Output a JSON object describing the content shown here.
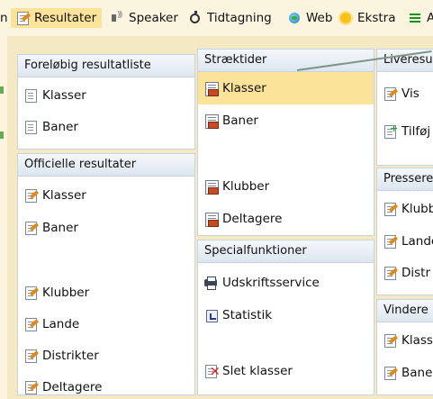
{
  "menubar": {
    "partial_left": "n",
    "items": [
      {
        "label": "Resultater",
        "icon": "result-doc-icon"
      },
      {
        "label": "Speaker",
        "icon": "speaker-icon"
      },
      {
        "label": "Tidtagning",
        "icon": "stopwatch-icon"
      },
      {
        "label": "Web",
        "icon": "globe-icon"
      },
      {
        "label": "Ekstra",
        "icon": "sun-icon"
      },
      {
        "label": "A",
        "icon": "list-icon"
      }
    ]
  },
  "groups": {
    "foreloebig": {
      "title": "Foreløbig resultatliste",
      "items": [
        "Klasser",
        "Baner"
      ]
    },
    "officielle": {
      "title": "Officielle resultater",
      "items": [
        "Klasser",
        "Baner",
        "Klubber",
        "Lande",
        "Distrikter",
        "Deltagere"
      ]
    },
    "straektider": {
      "title": "Stræktider",
      "items": [
        "Klasser",
        "Baner",
        "Klubber",
        "Deltagere"
      ]
    },
    "special": {
      "title": "Specialfunktioner",
      "items": [
        "Udskriftsservice",
        "Statistik",
        "Slet klasser"
      ]
    },
    "liveresul": {
      "title": "Liveresul",
      "items": [
        "Vis",
        "Tilføj"
      ]
    },
    "pressere": {
      "title": "Pressere",
      "items": [
        "Klubb",
        "Lande",
        "Distr"
      ]
    },
    "vindere": {
      "title": "Vindere",
      "items": [
        "Klass",
        "Bane"
      ]
    }
  },
  "colors": {
    "background": "#fbf4df",
    "highlight": "#fce39a",
    "panel_border": "#c7d3e0",
    "group_header": "#dde6ef"
  }
}
